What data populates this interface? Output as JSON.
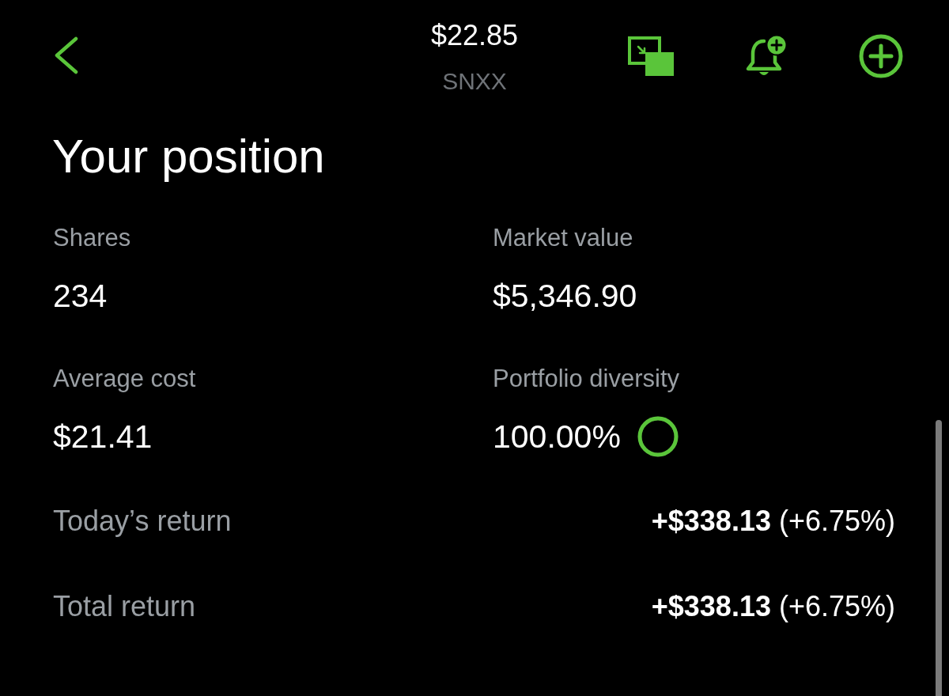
{
  "header": {
    "price": "$22.85",
    "ticker": "SNXX"
  },
  "title": "Your position",
  "stats": [
    {
      "kind": "plain",
      "label": "Shares",
      "value": "234"
    },
    {
      "kind": "plain",
      "label": "Market value",
      "value": "$5,346.90"
    },
    {
      "kind": "plain",
      "label": "Average cost",
      "value": "$21.41"
    },
    {
      "kind": "ring",
      "label": "Portfolio diversity",
      "value": "100.00%",
      "level": 1
    }
  ],
  "returns": [
    {
      "label": "Today’s return",
      "value": "**+$338.13** (+6.75%)"
    },
    {
      "label": "Total return",
      "value": "**+$338.13** (+6.75%)"
    }
  ]
}
